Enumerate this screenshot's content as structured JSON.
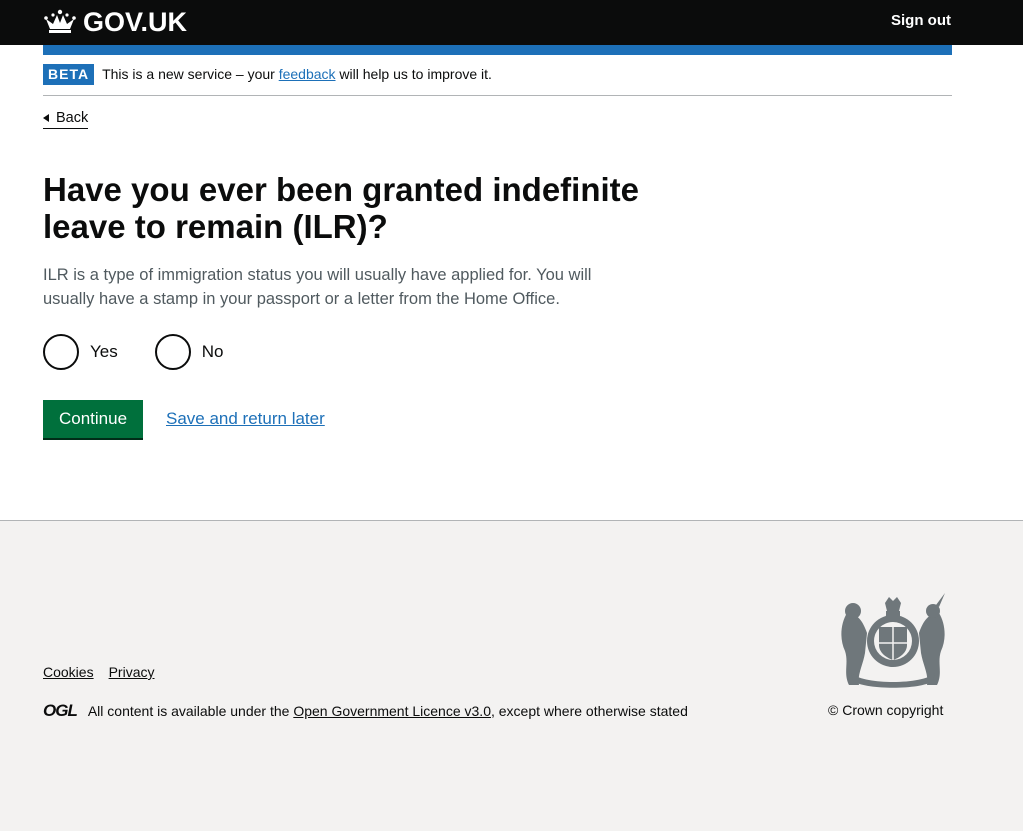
{
  "header": {
    "logo_text": "GOV.UK",
    "sign_out": "Sign out"
  },
  "phase_banner": {
    "tag": "BETA",
    "text_before": "This is a new service – your ",
    "feedback_link": "feedback",
    "text_after": " will help us to improve it."
  },
  "back_link": "Back",
  "question": {
    "heading": "Have you ever been granted indefinite leave to remain (ILR)?",
    "hint": "ILR is a type of immigration status you will usually have applied for. You will usually have a stamp in your passport or a letter from the Home Office.",
    "options": [
      {
        "label": "Yes",
        "selected": false
      },
      {
        "label": "No",
        "selected": false
      }
    ]
  },
  "actions": {
    "continue": "Continue",
    "save_later": "Save and return later"
  },
  "footer": {
    "links": [
      "Cookies",
      "Privacy"
    ],
    "ogl_logo": "OGL",
    "licence_before": "All content is available under the ",
    "licence_link": "Open Government Licence v3.0",
    "licence_after": ", except where otherwise stated",
    "copyright": "© Crown copyright"
  },
  "colors": {
    "header_bg": "#0b0c0c",
    "brand_blue": "#1d70b8",
    "button_green": "#00703c",
    "footer_bg": "#f3f2f1",
    "hint_grey": "#505a5f"
  }
}
